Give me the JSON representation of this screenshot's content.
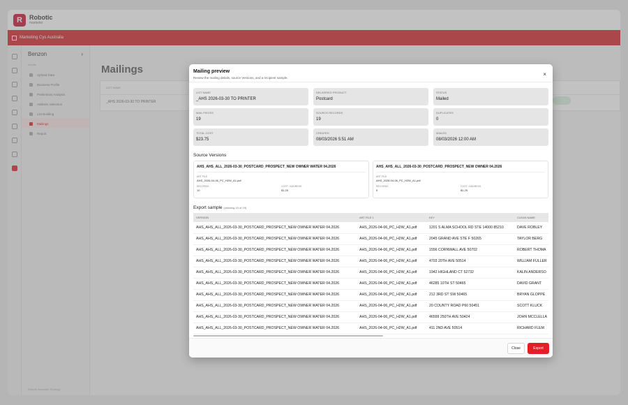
{
  "app": {
    "logo_mark": "R",
    "logo_name": "Robotic",
    "logo_tag": "marketer",
    "topbar_label": "Marketing Cys Australia",
    "org_name": "Benzon",
    "section_label": "results",
    "nav": [
      "Upload Data",
      "Business Profile",
      "Preliminary Analysis",
      "Address Selection",
      "List Building",
      "Mailings",
      "Report"
    ],
    "nav_footer": "Robotic Marketer Strategy",
    "page_title": "Mailings",
    "bg_col1": "LIST NAME",
    "bg_row1": "_AHS 2026-03-30 TO PRINTER"
  },
  "modal": {
    "title": "Mailing preview",
    "subtitle": "Review the mailing details, source Versions, and a recipient sample.",
    "close_icon": "×",
    "fields": [
      {
        "label": "LIST NAME",
        "value": "_AHS 2026-03-30 TO PRINTER"
      },
      {
        "label": "DELIVERED PRODUCT",
        "value": "Postcard"
      },
      {
        "label": "STATUS",
        "value": "Mailed"
      },
      {
        "label": "MAIL PIECES",
        "value": "19"
      },
      {
        "label": "SOURCE RECORDS",
        "value": "19"
      },
      {
        "label": "DUPLICATES",
        "value": "0"
      },
      {
        "label": "TOTAL COST",
        "value": "$23.75"
      },
      {
        "label": "CREATED",
        "value": "08/03/2026 5:51 AM"
      },
      {
        "label": "MAILED",
        "value": "08/03/2026 12:00 AM"
      }
    ],
    "versions_title": "Source Versions",
    "versions": [
      {
        "name": "AHS_AHS_ALL_2026-03-30_POSTCARD_PROSPECT_NEW OWNER WATER 04.2026",
        "art_label": "ART FILE",
        "art": "AHS_2026-04-06_PC_H2W_A1.pdf",
        "records_label": "RECORDS",
        "records": "10",
        "cost_label": "COST / ADDRESS",
        "cost": "$1.25"
      },
      {
        "name": "AHS_AHS_ALL_2026-03-30_POSTCARD_PROSPECT_NEW OWNER 04.2026",
        "art_label": "ART FILE",
        "art": "AHS_2026-04-06_PC_H2W_A1.pdf",
        "records_label": "RECORDS",
        "records": "9",
        "cost_label": "COST / ADDRESS",
        "cost": "$1.25"
      }
    ],
    "export_title": "Export sample",
    "export_note": "(showing 10 of 19)",
    "columns": [
      "VERSION",
      "ART FILE 1",
      "KEY",
      "CLEAN NAME"
    ],
    "rows": [
      [
        "AHS_AHS_ALL_2026-03-30_POSTCARD_PROSPECT_NEW OWNER WATER 04.2026",
        "AHS_2026-04-06_PC_H2W_A1.pdf",
        "1201 S ALMA SCHOOL RD STE 14000 85210",
        "DAVE ROBLEY"
      ],
      [
        "AHS_AHS_ALL_2026-03-30_POSTCARD_PROSPECT_NEW OWNER WATER 04.2026",
        "AHS_2026-04-06_PC_H2W_A1.pdf",
        "2045 GRAND AVE STE F 50265",
        "TAYLOR BERG"
      ],
      [
        "AHS_AHS_ALL_2026-03-30_POSTCARD_PROSPECT_NEW OWNER WATER 04.2026",
        "AHS_2026-04-06_PC_H2W_A1.pdf",
        "1556 CORNWALL AVE 50702",
        "ROBERT THOMA"
      ],
      [
        "AHS_AHS_ALL_2026-03-30_POSTCARD_PROSPECT_NEW OWNER WATER 04.2026",
        "AHS_2026-04-06_PC_H2W_A1.pdf",
        "4703 20TH AVE 50514",
        "WILLIAM FULLER"
      ],
      [
        "AHS_AHS_ALL_2026-03-30_POSTCARD_PROSPECT_NEW OWNER WATER 04.2026",
        "AHS_2026-04-06_PC_H2W_A1.pdf",
        "1942 HIGHLAND CT 52732",
        "KALIN ANDERSO"
      ],
      [
        "AHS_AHS_ALL_2026-03-30_POSTCARD_PROSPECT_NEW OWNER WATER 04.2026",
        "AHS_2026-04-06_PC_H2W_A1.pdf",
        "46285 10TH ST 50465",
        "DAVID GRANT"
      ],
      [
        "AHS_AHS_ALL_2026-03-30_POSTCARD_PROSPECT_NEW OWNER WATER 04.2026",
        "AHS_2026-04-06_PC_H2W_A1.pdf",
        "212 3RD ST SW 50465",
        "BRYAN GLOPPE"
      ],
      [
        "AHS_AHS_ALL_2026-03-30_POSTCARD_PROSPECT_NEW OWNER WATER 04.2026",
        "AHS_2026-04-06_PC_H2W_A1.pdf",
        "20 COUNTY ROAD P60 50451",
        "SCOTT KLUCK"
      ],
      [
        "AHS_AHS_ALL_2026-03-30_POSTCARD_PROSPECT_NEW OWNER WATER 04.2026",
        "AHS_2026-04-06_PC_H2W_A1.pdf",
        "46599 250TH AVE 50424",
        "JOHN MCCLELLA"
      ],
      [
        "AHS_AHS_ALL_2026-03-30_POSTCARD_PROSPECT_NEW OWNER WATER 04.2026",
        "AHS_2026-04-06_PC_H2W_A1.pdf",
        "411 2ND AVE 50514",
        "RICHARD FLEM"
      ]
    ],
    "close_label": "Close",
    "export_label": "Export"
  },
  "colors": {
    "brand_red": "#d31f26",
    "export_button": "#e31e26"
  }
}
